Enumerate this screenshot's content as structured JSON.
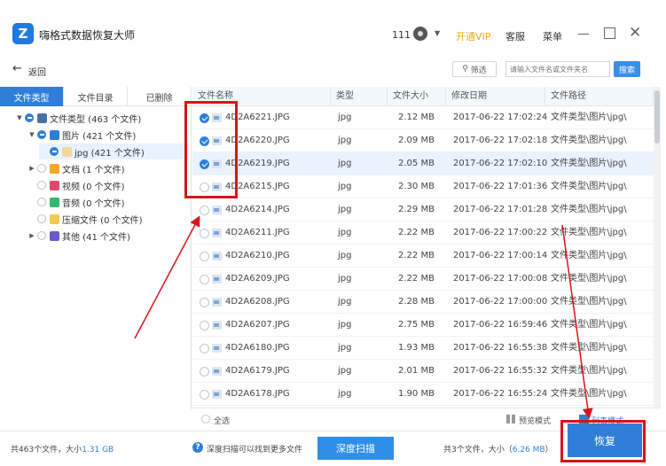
{
  "app": {
    "logo_letter": "Z",
    "title": "嗨格式数据恢复大师",
    "user": "111",
    "vip": "开通VIP",
    "service": "客服",
    "menu": "菜单"
  },
  "toolbar": {
    "back": "返回",
    "filter": "筛选",
    "search_placeholder": "请输入文件名或文件夹名",
    "search_button": "搜索"
  },
  "tabs": [
    "文件类型",
    "文件目录",
    "已删除"
  ],
  "tree": [
    {
      "label": "文件类型 (463 个文件)",
      "toggle": "▼",
      "check": "partial",
      "icon_color": "#4a6fa5",
      "indent": 0
    },
    {
      "label": "图片 (421 个文件)",
      "toggle": "▼",
      "check": "partial",
      "icon_color": "#2f7fd8",
      "indent": 1
    },
    {
      "label": "jpg (421 个文件)",
      "toggle": "",
      "check": "partial",
      "icon_color": "#f3d79b",
      "indent": 2
    },
    {
      "label": "文档 (1 个文件)",
      "toggle": "▶",
      "check": "none",
      "icon_color": "#f5a623",
      "indent": 1
    },
    {
      "label": "视频 (0 个文件)",
      "toggle": "",
      "check": "none",
      "icon_color": "#e04a6a",
      "indent": 1
    },
    {
      "label": "音频 (0 个文件)",
      "toggle": "",
      "check": "none",
      "icon_color": "#2eb872",
      "indent": 1
    },
    {
      "label": "压缩文件 (0 个文件)",
      "toggle": "",
      "check": "none",
      "icon_color": "#f2c94c",
      "indent": 1
    },
    {
      "label": "其他 (41 个文件)",
      "toggle": "▶",
      "check": "none",
      "icon_color": "#6a5acd",
      "indent": 1
    }
  ],
  "table": {
    "headers": [
      "文件名称",
      "类型",
      "文件大小",
      "修改日期",
      "文件路径"
    ],
    "rows": [
      {
        "name": "4D2A6221.JPG",
        "type": "jpg",
        "size": "2.12 MB",
        "date": "2017-06-22 17:02:24",
        "path": "文件类型\\图片\\jpg\\",
        "checked": true
      },
      {
        "name": "4D2A6220.JPG",
        "type": "jpg",
        "size": "2.09 MB",
        "date": "2017-06-22 17:02:18",
        "path": "文件类型\\图片\\jpg\\",
        "checked": true
      },
      {
        "name": "4D2A6219.JPG",
        "type": "jpg",
        "size": "2.05 MB",
        "date": "2017-06-22 17:02:10",
        "path": "文件类型\\图片\\jpg\\",
        "checked": true
      },
      {
        "name": "4D2A6215.JPG",
        "type": "jpg",
        "size": "2.30 MB",
        "date": "2017-06-22 17:01:36",
        "path": "文件类型\\图片\\jpg\\",
        "checked": false
      },
      {
        "name": "4D2A6214.JPG",
        "type": "jpg",
        "size": "2.29 MB",
        "date": "2017-06-22 17:01:28",
        "path": "文件类型\\图片\\jpg\\",
        "checked": false
      },
      {
        "name": "4D2A6211.JPG",
        "type": "jpg",
        "size": "2.22 MB",
        "date": "2017-06-22 17:00:22",
        "path": "文件类型\\图片\\jpg\\",
        "checked": false
      },
      {
        "name": "4D2A6210.JPG",
        "type": "jpg",
        "size": "2.22 MB",
        "date": "2017-06-22 17:00:14",
        "path": "文件类型\\图片\\jpg\\",
        "checked": false
      },
      {
        "name": "4D2A6209.JPG",
        "type": "jpg",
        "size": "2.22 MB",
        "date": "2017-06-22 17:00:08",
        "path": "文件类型\\图片\\jpg\\",
        "checked": false
      },
      {
        "name": "4D2A6208.JPG",
        "type": "jpg",
        "size": "2.28 MB",
        "date": "2017-06-22 17:00:00",
        "path": "文件类型\\图片\\jpg\\",
        "checked": false
      },
      {
        "name": "4D2A6207.JPG",
        "type": "jpg",
        "size": "2.75 MB",
        "date": "2017-06-22 16:59:46",
        "path": "文件类型\\图片\\jpg\\",
        "checked": false
      },
      {
        "name": "4D2A6180.JPG",
        "type": "jpg",
        "size": "1.93 MB",
        "date": "2017-06-22 16:55:38",
        "path": "文件类型\\图片\\jpg\\",
        "checked": false
      },
      {
        "name": "4D2A6179.JPG",
        "type": "jpg",
        "size": "2.01 MB",
        "date": "2017-06-22 16:55:32",
        "path": "文件类型\\图片\\jpg\\",
        "checked": false
      },
      {
        "name": "4D2A6178.JPG",
        "type": "jpg",
        "size": "1.90 MB",
        "date": "2017-06-22 16:55:24",
        "path": "文件类型\\图片\\jpg\\",
        "checked": false
      }
    ]
  },
  "footer": {
    "select_all": "全选",
    "preview_mode": "预览模式",
    "list_mode": "列表模式"
  },
  "status": {
    "total_prefix": "共463个文件，大小",
    "total_size": "1.31 GB",
    "deep_hint": "深度扫描可以找到更多文件",
    "deep_scan": "深度扫描",
    "selected_prefix": "共3个文件，大小（",
    "selected_size": "6.26 MB",
    "selected_suffix": "）",
    "recover": "恢复"
  },
  "colors": {
    "accent": "#2f7fd8",
    "vip": "#f5a623",
    "annotation": "#d6141b"
  }
}
